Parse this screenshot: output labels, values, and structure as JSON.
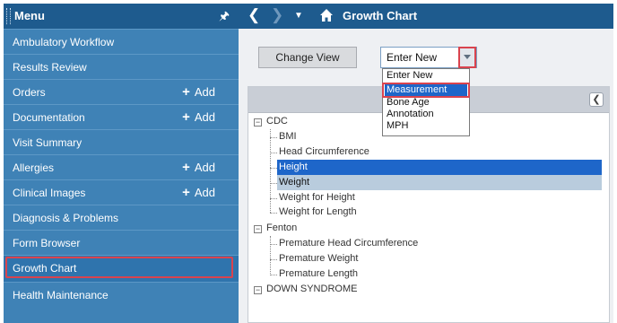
{
  "sidebar": {
    "title": "Menu",
    "items": [
      {
        "label": "Ambulatory Workflow"
      },
      {
        "label": "Results Review"
      },
      {
        "label": "Orders",
        "add": "Add"
      },
      {
        "label": "Documentation",
        "add": "Add"
      },
      {
        "label": "Visit Summary"
      },
      {
        "label": "Allergies",
        "add": "Add"
      },
      {
        "label": "Clinical Images",
        "add": "Add"
      },
      {
        "label": "Diagnosis & Problems"
      },
      {
        "label": "Form Browser"
      },
      {
        "label": "Growth Chart",
        "selected": true
      },
      {
        "label": "Health Maintenance"
      }
    ]
  },
  "topbar": {
    "title": "Growth Chart"
  },
  "toolbar": {
    "change_view": "Change View",
    "enter_new": "Enter New"
  },
  "dropdown": {
    "options": [
      "Enter New",
      "Measurement",
      "Bone Age",
      "Annotation",
      "MPH"
    ],
    "highlighted": "Measurement"
  },
  "tree": {
    "cdc": {
      "label": "CDC",
      "children": [
        "BMI",
        "Head Circumference",
        "Height",
        "Weight",
        "Weight for Height",
        "Weight for Length"
      ]
    },
    "fenton": {
      "label": "Fenton",
      "children": [
        "Premature Head Circumference",
        "Premature Weight",
        "Premature Length"
      ]
    },
    "down": {
      "label": "DOWN SYNDROME"
    }
  },
  "colors": {
    "sidebar_bg": "#3f82b6",
    "header_bg": "#1e5b8e",
    "highlight_outline": "#d9434e",
    "selection": "#1e66c9"
  }
}
